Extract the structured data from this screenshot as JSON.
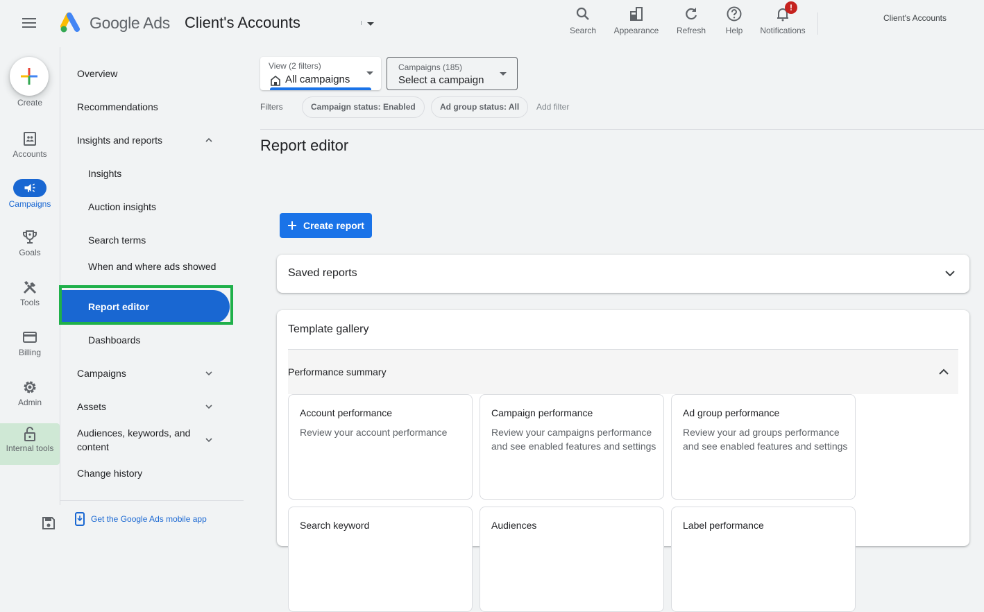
{
  "header": {
    "brand": "Google Ads",
    "account_title": "Client's Accounts",
    "tools": [
      {
        "label": "Search",
        "icon": "search-icon"
      },
      {
        "label": "Appearance",
        "icon": "appearance-icon"
      },
      {
        "label": "Refresh",
        "icon": "refresh-icon"
      },
      {
        "label": "Help",
        "icon": "help-icon"
      },
      {
        "label": "Notifications",
        "icon": "bell-icon",
        "badge": "!"
      }
    ],
    "account_name": "Client's Accounts"
  },
  "rail": {
    "create": "Create",
    "items": [
      {
        "label": "Accounts",
        "icon": "accounts-icon"
      },
      {
        "label": "Campaigns",
        "icon": "megaphone-icon",
        "active": true
      },
      {
        "label": "Goals",
        "icon": "trophy-icon"
      },
      {
        "label": "Tools",
        "icon": "tools-icon"
      },
      {
        "label": "Billing",
        "icon": "credit-card-icon"
      },
      {
        "label": "Admin",
        "icon": "gear-icon"
      },
      {
        "label": "Internal tools",
        "icon": "lock-icon"
      }
    ]
  },
  "nav": {
    "items": [
      {
        "label": "Overview"
      },
      {
        "label": "Recommendations"
      },
      {
        "label": "Insights and reports",
        "expanded": true
      },
      {
        "label": "Insights"
      },
      {
        "label": "Auction insights"
      },
      {
        "label": "Search terms"
      },
      {
        "label": "When and where ads showed"
      },
      {
        "label": "Report editor",
        "active": true
      },
      {
        "label": "Dashboards"
      },
      {
        "label": "Campaigns",
        "expanded": false
      },
      {
        "label": "Assets",
        "expanded": false
      },
      {
        "label": "Audiences, keywords, and content",
        "expanded": false
      },
      {
        "label": "Change history"
      }
    ],
    "mobile_app": "Get the Google Ads mobile app"
  },
  "main": {
    "view_select": {
      "label": "View (2 filters)",
      "value": "All campaigns"
    },
    "campaign_select": {
      "label": "Campaigns (185)",
      "value": "Select a campaign"
    },
    "filters_label": "Filters",
    "chips": [
      "Campaign status: Enabled",
      "Ad group status: All"
    ],
    "add_filter": "Add filter",
    "page_title": "Report editor",
    "create_report": "Create report",
    "saved_reports": "Saved reports",
    "template_gallery": "Template gallery",
    "section": "Performance summary",
    "templates": [
      {
        "title": "Account performance",
        "desc": "Review your account performance"
      },
      {
        "title": "Campaign performance",
        "desc": "Review your campaigns performance and see enabled features and settings"
      },
      {
        "title": "Ad group performance",
        "desc": "Review your ad groups performance and see enabled features and settings"
      },
      {
        "title": "Search keyword",
        "desc": ""
      },
      {
        "title": "Audiences",
        "desc": ""
      },
      {
        "title": "Label performance",
        "desc": ""
      }
    ]
  },
  "colors": {
    "accent": "#1a73e8",
    "active_nav": "#1967d2",
    "highlight": "#1fb04a",
    "notification": "#c5221f",
    "internal_tools_bg": "#cfe8d5"
  }
}
